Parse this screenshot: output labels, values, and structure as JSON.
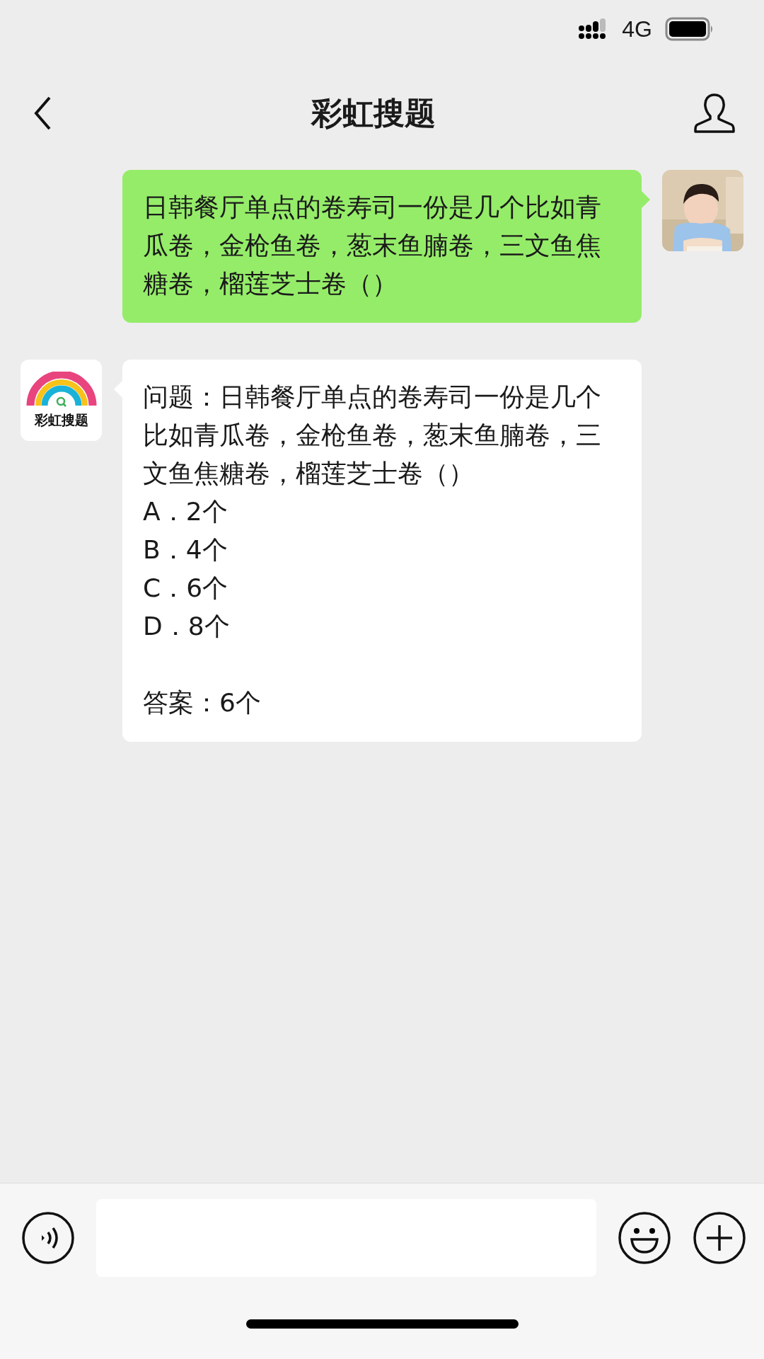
{
  "status_bar": {
    "network": "4G"
  },
  "nav": {
    "title": "彩虹搜题"
  },
  "messages": [
    {
      "kind": "user",
      "text": "日韩餐厅单点的卷寿司一份是几个比如青瓜卷，金枪鱼卷，葱末鱼腩卷，三文鱼焦糖卷，榴莲芝士卷（）"
    },
    {
      "kind": "bot",
      "avatar_label": "彩虹搜题",
      "question": "问题：日韩餐厅单点的卷寿司一份是几个比如青瓜卷，金枪鱼卷，葱末鱼腩卷，三文鱼焦糖卷，榴莲芝士卷（）",
      "options": [
        "A．2个",
        "B．4个",
        "C．6个",
        "D．8个"
      ],
      "answer": "答案：6个"
    }
  ]
}
